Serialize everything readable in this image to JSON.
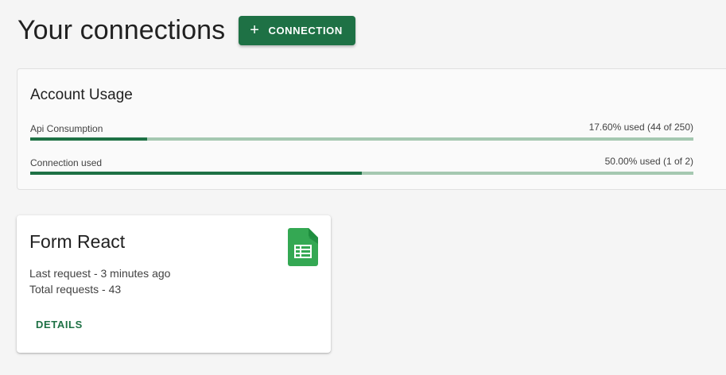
{
  "header": {
    "title": "Your connections",
    "add_button_icon": "+",
    "add_button_label": "CONNECTION"
  },
  "usage": {
    "title": "Account Usage",
    "rows": [
      {
        "label": "Api Consumption",
        "value": "17.60% used (44 of 250)",
        "fraction": 0.176
      },
      {
        "label": "Connection used",
        "value": "50.00% used (1 of 2)",
        "fraction": 0.5
      }
    ]
  },
  "connections": [
    {
      "title": "Form React",
      "icon": "google-sheets-icon",
      "last_request": "Last request - 3 minutes ago",
      "total_requests": "Total requests - 43",
      "details_label": "DETAILS"
    }
  ],
  "colors": {
    "primary": "#1e7145",
    "track": "#a5c8b1",
    "sheets_green": "#34a853"
  }
}
